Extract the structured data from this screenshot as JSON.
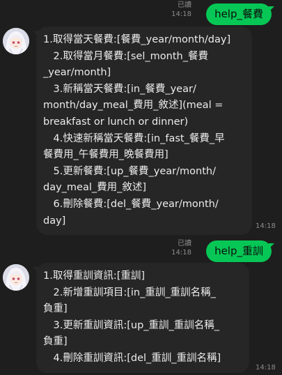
{
  "messages": [
    {
      "read_label": "已讀",
      "time": "14:18",
      "text": "help_餐費"
    },
    {
      "time": "14:18",
      "lines": [
        "1.取得當天餐費:[餐費_year/month/day]",
        "　2.取得當月餐費:[sel_month_餐費",
        "_year/month]",
        "　3.新稱當天餐費:[in_餐費_year/",
        "month/day_meal_費用_敘述](meal =",
        "breakfast or lunch or dinner)",
        "　4.快速新稱當天餐費:[in_fast_餐費_早",
        "餐費用_午餐費用_晚餐費用]",
        "　5.更新餐費:[up_餐費_year/month/",
        "day_meal_費用_敘述]",
        "　6.刪除餐費:[del_餐費_year/month/",
        "day]"
      ]
    },
    {
      "read_label": "已讀",
      "time": "14:18",
      "text": "help_重訓"
    },
    {
      "time": "14:18",
      "lines": [
        "1.取得重訓資訊:[重訓]",
        "　2.新增重訓項目:[in_重訓_重訓名稱_",
        "負重]",
        "　3.更新重訓資訊:[up_重訓_重訓名稱_",
        "負重]",
        "　4.刪除重訓資訊:[del_重訓_重訓名稱]"
      ]
    }
  ],
  "colors": {
    "background": "#1e1e1e",
    "sent_bubble": "#06c755",
    "received_bubble": "#262626",
    "meta_text": "#8c8c8c"
  },
  "icons": {
    "avatar": "anime-girl-avatar"
  }
}
